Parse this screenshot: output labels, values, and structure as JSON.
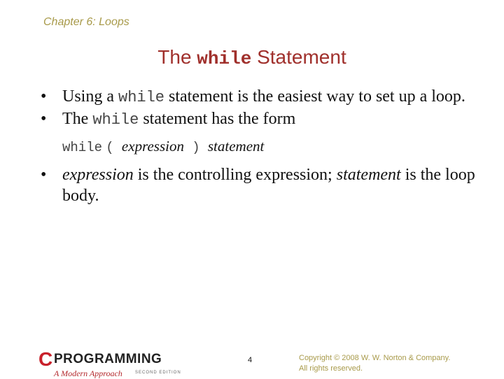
{
  "header": {
    "chapter": "Chapter 6: Loops"
  },
  "title": {
    "pre": "The ",
    "code": "while",
    "post": " Statement"
  },
  "bullets": [
    {
      "pre": "Using a ",
      "code": "while",
      "post": " statement is the easiest way to set up a loop."
    },
    {
      "pre": "The ",
      "code": "while",
      "post": " statement has the form"
    }
  ],
  "form": {
    "keyword": "while",
    "open": "(",
    "expr": "expression",
    "close": ")",
    "stmt": "statement"
  },
  "bullet3": {
    "expr": "expression",
    "mid": " is the controlling expression; ",
    "stmt": "statement",
    "post": " is the loop body."
  },
  "footer": {
    "logo_c": "C",
    "logo_word": "PROGRAMMING",
    "logo_sub": "A Modern Approach",
    "logo_edition": "SECOND EDITION",
    "page_number": "4",
    "copyright_line1": "Copyright © 2008 W. W. Norton & Company.",
    "copyright_line2": "All rights reserved."
  }
}
